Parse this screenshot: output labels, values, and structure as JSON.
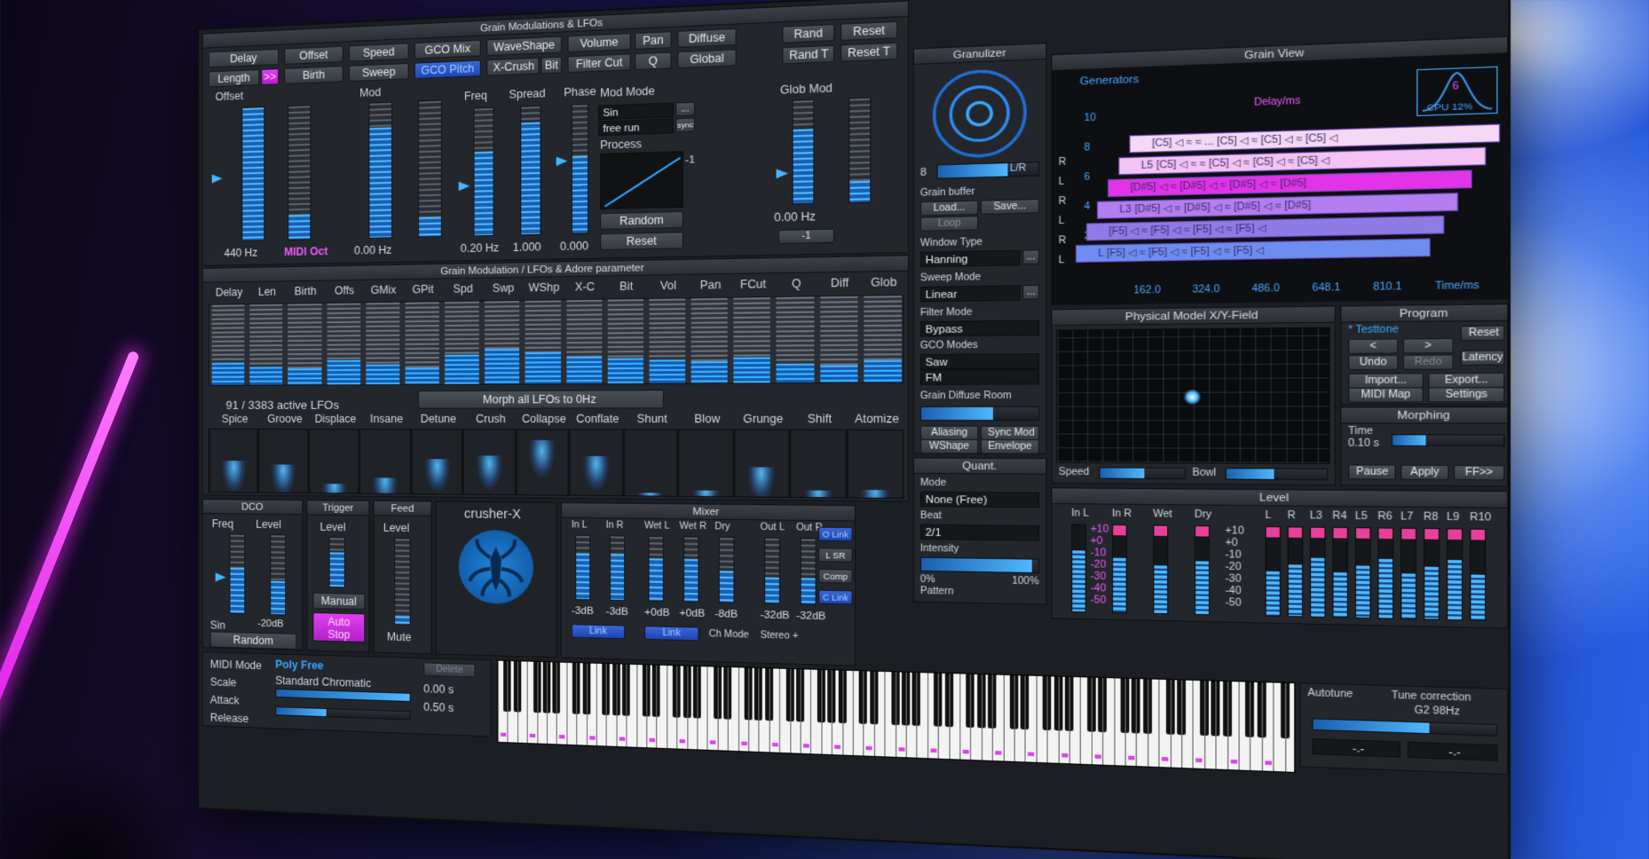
{
  "scene": {
    "accent": "#3ba7ff",
    "magenta": "#f25aff"
  },
  "grain_mod": {
    "title": "Grain Modulations & LFOs",
    "buttons": {
      "delay": "Delay",
      "offset": "Offset",
      "speed": "Speed",
      "gco_mix": "GCO Mix",
      "waveshape": "WaveShape",
      "volume": "Volume",
      "pan": "Pan",
      "diffuse": "Diffuse",
      "rand": "Rand",
      "reset": "Reset",
      "length": "Length",
      "arrow": ">>",
      "birth": "Birth",
      "sweep": "Sweep",
      "gco_pitch": "GCO Pitch",
      "xcrush": "X-Crush",
      "bit": "Bit",
      "filter_cut": "Filter Cut",
      "q": "Q",
      "global": "Global",
      "rand_t": "Rand T",
      "reset_t": "Reset T"
    },
    "labels": {
      "offset": "Offset",
      "mod": "Mod",
      "freq": "Freq",
      "spread": "Spread",
      "phase": "Phase",
      "mod_mode": "Mod Mode",
      "glob_mod": "Glob Mod",
      "process": "Process"
    },
    "values": {
      "offset_hz": "440 Hz",
      "midi_oct": "MIDI Oct",
      "mod_hz": "0.00 Hz",
      "freq_hz": "0.20 Hz",
      "spread": "1.000",
      "phase": "0.000",
      "glob_hz": "0.00 Hz",
      "glob_minus": "-1",
      "proc_minus": "-1"
    },
    "mod_mode": {
      "wave": "Sin",
      "wave_btn": "...",
      "run": "free run",
      "sync": "sync"
    },
    "random": "Random",
    "reset_btn": "Reset"
  },
  "lfo_param": {
    "title": "Grain Modulation / LFOs & Adore parameter",
    "columns": [
      "Delay",
      "Len",
      "Birth",
      "Offs",
      "GMix",
      "GPit",
      "Spd",
      "Swp",
      "WShp",
      "X-C",
      "Bit",
      "Vol",
      "Pan",
      "FCut",
      "Q",
      "Diff",
      "Glob"
    ],
    "levels": [
      0.28,
      0.22,
      0.2,
      0.3,
      0.24,
      0.2,
      0.36,
      0.42,
      0.38,
      0.32,
      0.3,
      0.28,
      0.26,
      0.3,
      0.22,
      0.2,
      0.26
    ],
    "active": "91 / 3383  active LFOs",
    "morph": "Morph all LFOs to 0Hz"
  },
  "adore": {
    "columns": [
      "Spice",
      "Groove",
      "Displace",
      "Insane",
      "Detune",
      "Crush",
      "Collapse",
      "Conflate",
      "Shunt",
      "Blow",
      "Grunge",
      "Shift",
      "Atomize"
    ],
    "levels": [
      0.5,
      0.45,
      0.15,
      0.25,
      0.55,
      0.6,
      0.85,
      0.6,
      0.05,
      0.08,
      0.45,
      0.1,
      0.12
    ]
  },
  "granulizer": {
    "title": "Granulizer",
    "count": "8",
    "lr": "L/R",
    "grain_buffer": "Grain buffer",
    "load": "Load...",
    "save": "Save...",
    "loop": "Loop",
    "window_type": "Window Type",
    "window_val": "Hanning",
    "sweep_mode": "Sweep Mode",
    "sweep_val": "Linear",
    "filter_mode": "Filter Mode",
    "filter_val": "Bypass",
    "gco_modes": "GCO Modes",
    "gco_saw": "Saw",
    "gco_fm": "FM",
    "diffuse_room": "Grain Diffuse Room",
    "aliasing": "Aliasing",
    "sync_mod": "Sync Mod",
    "wshape": "WShape",
    "envelope": "Envelope",
    "dots": "..."
  },
  "quant": {
    "title": "Quant.",
    "mode": "Mode",
    "mode_val": "None (Free)",
    "beat": "Beat",
    "beat_val": "2/1",
    "intensity": "Intensity",
    "zero": "0%",
    "hundred": "100%",
    "pattern": "Pattern",
    "pattern_val": "--"
  },
  "grain_view": {
    "title": "Grain View",
    "generators": "Generators",
    "delay_ms": "Delay/ms",
    "cpu": "CPU 12%",
    "gen_count": "6",
    "y_ticks": [
      "10",
      "8",
      "6",
      "4",
      "2"
    ],
    "lr": [
      "R",
      "L",
      "R",
      "L",
      "R",
      "L"
    ],
    "x_ticks": [
      "162.0",
      "324.0",
      "486.0",
      "648.1",
      "810.1"
    ],
    "time": "Time/ms",
    "rows": [
      {
        "label": "[C5] ◁ ≈ ≈ ... [C5] ◁ ≈ [C5] ◁ ≈ [C5] ◁",
        "color": "#f5d8f5"
      },
      {
        "label": "L5 [C5] ◁ ≈ ≈ [C5] ◁ ≈ [C5] ◁ ≈ [C5] ◁",
        "color": "#f3c4f3"
      },
      {
        "label": "[D#5] ◁ ≈ [D#5] ◁ ≈ [D#5] ◁ ≈ [D#5]",
        "color": "#e233e8"
      },
      {
        "label": "L3 [D#5] ◁ ≈ [D#5] ◁ ≈ [D#5] ◁ ≈ [D#5]",
        "color": "#b37ef0"
      },
      {
        "label": "[F5] ◁ ≈ [F5] ◁ ≈ [F5] ◁ ≈ [F5] ◁",
        "color": "#8f7be6"
      },
      {
        "label": "L [F5] ◁ ≈ [F5] ◁ ≈ [F5] ◁ ≈ [F5] ◁",
        "color": "#6d8df0"
      }
    ]
  },
  "xy_field": {
    "title": "Physical Model X/Y-Field",
    "speed": "Speed",
    "bowl": "Bowl"
  },
  "program": {
    "title": "Program",
    "name": "* Testtone",
    "reset": "Reset",
    "prev": "<",
    "next": ">",
    "undo": "Undo",
    "redo": "Redo",
    "latency": "Latency",
    "import": "Import...",
    "export": "Export...",
    "midi_map": "MIDI Map",
    "settings": "Settings"
  },
  "morphing": {
    "title": "Morphing",
    "time": "Time",
    "time_val": "0.10 s",
    "pause": "Pause",
    "apply": "Apply",
    "ff": "FF>>"
  },
  "level": {
    "title": "Level",
    "channels": [
      "In L",
      "In R",
      "Wet",
      "Dry"
    ],
    "scale": [
      "+10",
      "+0",
      "-10",
      "-20",
      "-30",
      "-40",
      "-50"
    ],
    "outputs": [
      "L",
      "R",
      "L3",
      "R4",
      "L5",
      "R6",
      "L7",
      "R8",
      "L9",
      "R10"
    ]
  },
  "dco": {
    "title": "DCO",
    "freq": "Freq",
    "level": "Level",
    "db": "-20dB",
    "sin": "Sin",
    "random": "Random"
  },
  "trigger": {
    "title": "Trigger",
    "level": "Level",
    "manual": "Manual",
    "auto_stop": "Auto Stop"
  },
  "feed": {
    "title": "Feed",
    "level": "Level",
    "mute": "Mute"
  },
  "crusher": {
    "title": "crusher-X"
  },
  "mixer": {
    "title": "Mixer",
    "channels": [
      "In L",
      "In R",
      "Wet L",
      "Wet R",
      "Dry",
      "Out L",
      "Out R"
    ],
    "values": [
      "-3dB",
      "-3dB",
      "+0dB",
      "+0dB",
      "-8dB",
      "-32dB",
      "-32dB"
    ],
    "link": "Link",
    "ch_mode": "Ch Mode",
    "stereo": "Stereo +",
    "side": [
      "O Link",
      "L SR",
      "Comp",
      "C Link"
    ]
  },
  "midi": {
    "midi_mode": "MIDI Mode",
    "mode_val": "Poly Free",
    "delete": "Delete",
    "scale": "Scale",
    "scale_val": "Standard Chromatic",
    "attack": "Attack",
    "attack_val": "0.00 s",
    "release": "Release",
    "release_val": "0.50 s"
  },
  "autotune": {
    "label": "Autotune",
    "tune": "Tune correction",
    "note": "G2 98Hz",
    "a": "-.-",
    "b": "-.-"
  }
}
